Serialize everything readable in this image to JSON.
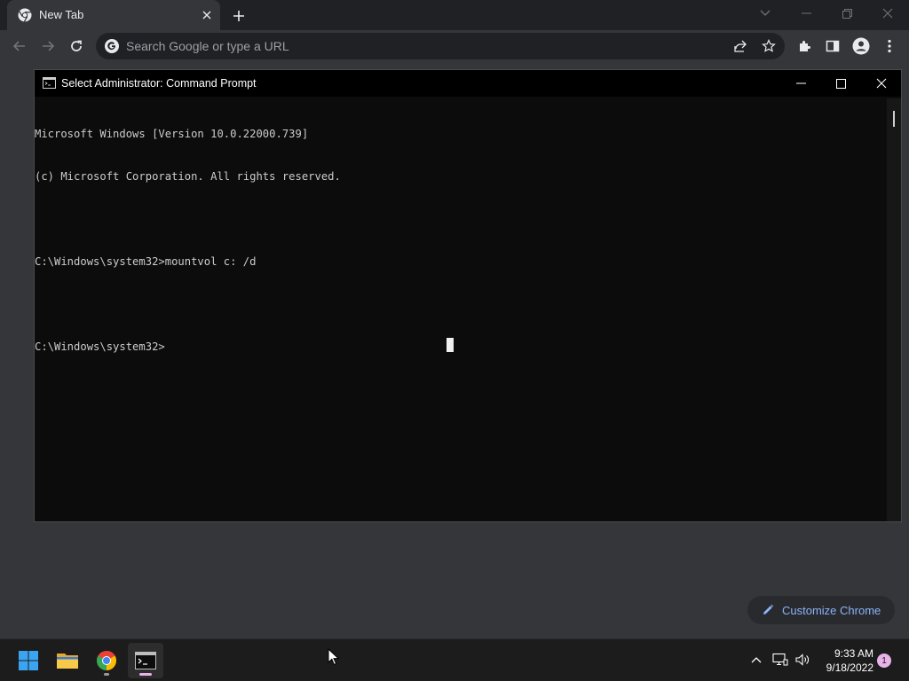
{
  "browser": {
    "tab": {
      "title": "New Tab",
      "favicon": "chrome-icon"
    },
    "omnibox": {
      "placeholder": "Search Google or type a URL"
    },
    "customize_label": "Customize Chrome"
  },
  "cmd_window": {
    "title": "Select Administrator: Command Prompt",
    "lines": [
      "Microsoft Windows [Version 10.0.22000.739]",
      "(c) Microsoft Corporation. All rights reserved.",
      "",
      "C:\\Windows\\system32>mountvol c: /d",
      "",
      "C:\\Windows\\system32>"
    ]
  },
  "taskbar": {
    "apps": [
      "windows-start-icon",
      "file-explorer-icon",
      "chrome-icon",
      "command-prompt-icon"
    ],
    "clock": {
      "time": "9:33 AM",
      "date": "9/18/2022"
    },
    "notification_count": "1"
  },
  "colors": {
    "accent": "#8ab4f8",
    "console_bg": "#0c0c0c",
    "console_text": "#cccccc",
    "taskbar_bg": "#1c1c1c"
  }
}
